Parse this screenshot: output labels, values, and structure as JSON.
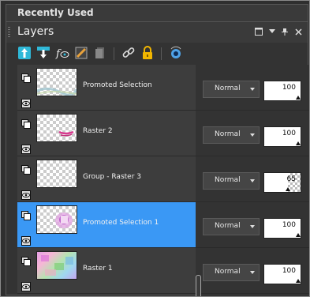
{
  "recently_used": {
    "title": "Recently Used"
  },
  "palette": {
    "title": "Layers"
  },
  "layers": [
    {
      "name": "Promoted Selection",
      "blend": "Normal",
      "opacity": 100,
      "opacity_label": "100"
    },
    {
      "name": "Raster 2",
      "blend": "Normal",
      "opacity": 100,
      "opacity_label": "100"
    },
    {
      "name": "Group - Raster 3",
      "blend": "Normal",
      "opacity": 65,
      "opacity_label": "65"
    },
    {
      "name": "Promoted Selection 1",
      "blend": "Normal",
      "opacity": 100,
      "opacity_label": "100",
      "selected": true
    },
    {
      "name": "Raster 1",
      "blend": "Normal",
      "opacity": 100,
      "opacity_label": "100"
    }
  ],
  "colors": {
    "selection": "#3a98f5",
    "panel": "#3d3d3d",
    "background": "#2f2f2f"
  },
  "toolbar_icons": [
    "new-raster-layer-icon",
    "new-layer-from-below-icon",
    "new-adjustment-layer-icon",
    "new-mask-layer-icon",
    "duplicate-layer-icon",
    "link-layers-icon",
    "lock-transparency-icon",
    "layer-visibility-toggle-icon"
  ],
  "title_controls": [
    "maximize-icon",
    "menu-dropdown-icon",
    "pin-icon",
    "close-icon"
  ]
}
